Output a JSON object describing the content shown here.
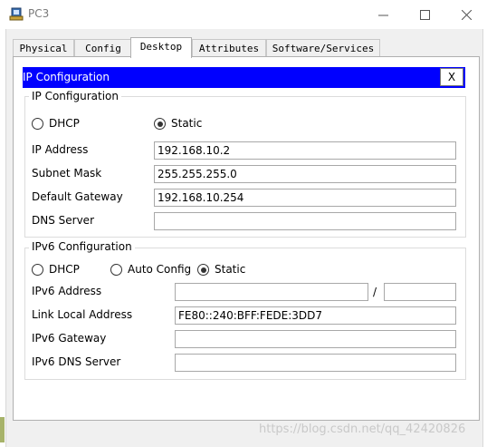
{
  "window": {
    "title": "PC3",
    "controls": [
      "minimize",
      "maximize",
      "close"
    ]
  },
  "tabs": [
    {
      "label": "Physical",
      "active": false
    },
    {
      "label": "Config",
      "active": false
    },
    {
      "label": "Desktop",
      "active": true
    },
    {
      "label": "Attributes",
      "active": false
    },
    {
      "label": "Software/Services",
      "active": false
    }
  ],
  "dialog": {
    "title": "IP Configuration",
    "close_label": "X",
    "header_color": "#0000ff"
  },
  "ipv4": {
    "legend": "IP Configuration",
    "mode_dhcp": "DHCP",
    "mode_static": "Static",
    "selected_mode": "Static",
    "ip_address_label": "IP Address",
    "ip_address": "192.168.10.2",
    "subnet_label": "Subnet Mask",
    "subnet": "255.255.255.0",
    "gateway_label": "Default Gateway",
    "gateway": "192.168.10.254",
    "dns_label": "DNS Server",
    "dns": ""
  },
  "ipv6": {
    "legend": "IPv6 Configuration",
    "mode_dhcp": "DHCP",
    "mode_auto": "Auto Config",
    "mode_static": "Static",
    "selected_mode": "Static",
    "address_label": "IPv6 Address",
    "address": "",
    "prefix_separator": "/",
    "prefix": "",
    "link_local_label": "Link Local Address",
    "link_local": "FE80::240:BFF:FEDE:3DD7",
    "gateway_label": "IPv6 Gateway",
    "gateway": "",
    "dns_label": "IPv6 DNS Server",
    "dns": ""
  },
  "watermark": "https://blog.csdn.net/qq_42420826"
}
